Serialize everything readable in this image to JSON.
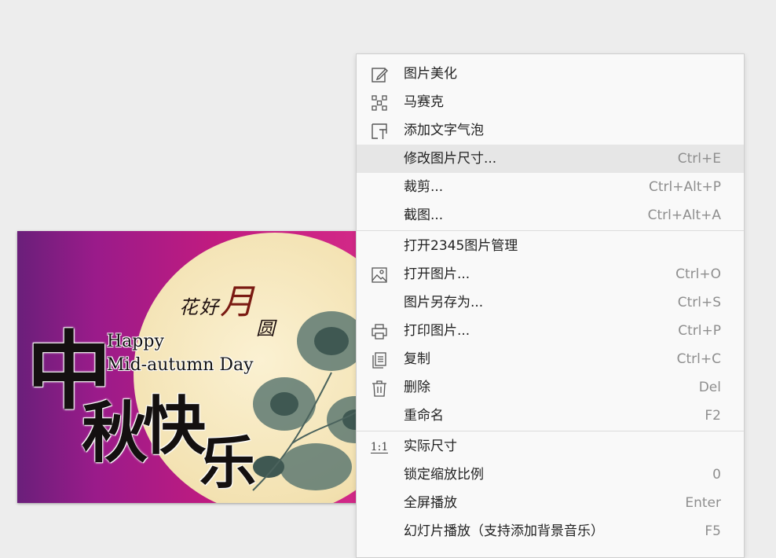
{
  "image_preview": {
    "verse_part1": "花好",
    "verse_red": "月",
    "verse_part2": "圆",
    "chinese_title": [
      "中",
      "秋",
      "快",
      "乐"
    ],
    "english_line1": "Happy",
    "english_line2": "Mid-autumn Day"
  },
  "context_menu": {
    "items": [
      {
        "label": "图片美化",
        "shortcut": "",
        "icon": "edit-icon"
      },
      {
        "label": "马赛克",
        "shortcut": "",
        "icon": "mosaic-icon"
      },
      {
        "label": "添加文字气泡",
        "shortcut": "",
        "icon": "text-bubble-icon"
      },
      {
        "label": "修改图片尺寸...",
        "shortcut": "Ctrl+E",
        "icon": ""
      },
      {
        "label": "裁剪...",
        "shortcut": "Ctrl+Alt+P",
        "icon": ""
      },
      {
        "label": "截图...",
        "shortcut": "Ctrl+Alt+A",
        "icon": ""
      },
      {
        "label": "打开2345图片管理",
        "shortcut": "",
        "icon": ""
      },
      {
        "label": "打开图片...",
        "shortcut": "Ctrl+O",
        "icon": "image-icon"
      },
      {
        "label": "图片另存为...",
        "shortcut": "Ctrl+S",
        "icon": ""
      },
      {
        "label": "打印图片...",
        "shortcut": "Ctrl+P",
        "icon": "printer-icon"
      },
      {
        "label": "复制",
        "shortcut": "Ctrl+C",
        "icon": "copy-icon"
      },
      {
        "label": "删除",
        "shortcut": "Del",
        "icon": "trash-icon"
      },
      {
        "label": "重命名",
        "shortcut": "F2",
        "icon": ""
      },
      {
        "label": "实际尺寸",
        "shortcut": "",
        "icon": "actual-size-icon",
        "icon_text": "1:1"
      },
      {
        "label": "锁定缩放比例",
        "shortcut": "0",
        "icon": ""
      },
      {
        "label": "全屏播放",
        "shortcut": "Enter",
        "icon": ""
      },
      {
        "label": "幻灯片播放（支持添加背景音乐）",
        "shortcut": "F5",
        "icon": ""
      }
    ]
  },
  "colors": {
    "menu_background": "#f9f9f9",
    "hover_background": "#e6e6e6",
    "shortcut_text": "#8e8e8e",
    "photo_magenta": "#c01b80",
    "moon_cream": "#f3e2b2"
  }
}
